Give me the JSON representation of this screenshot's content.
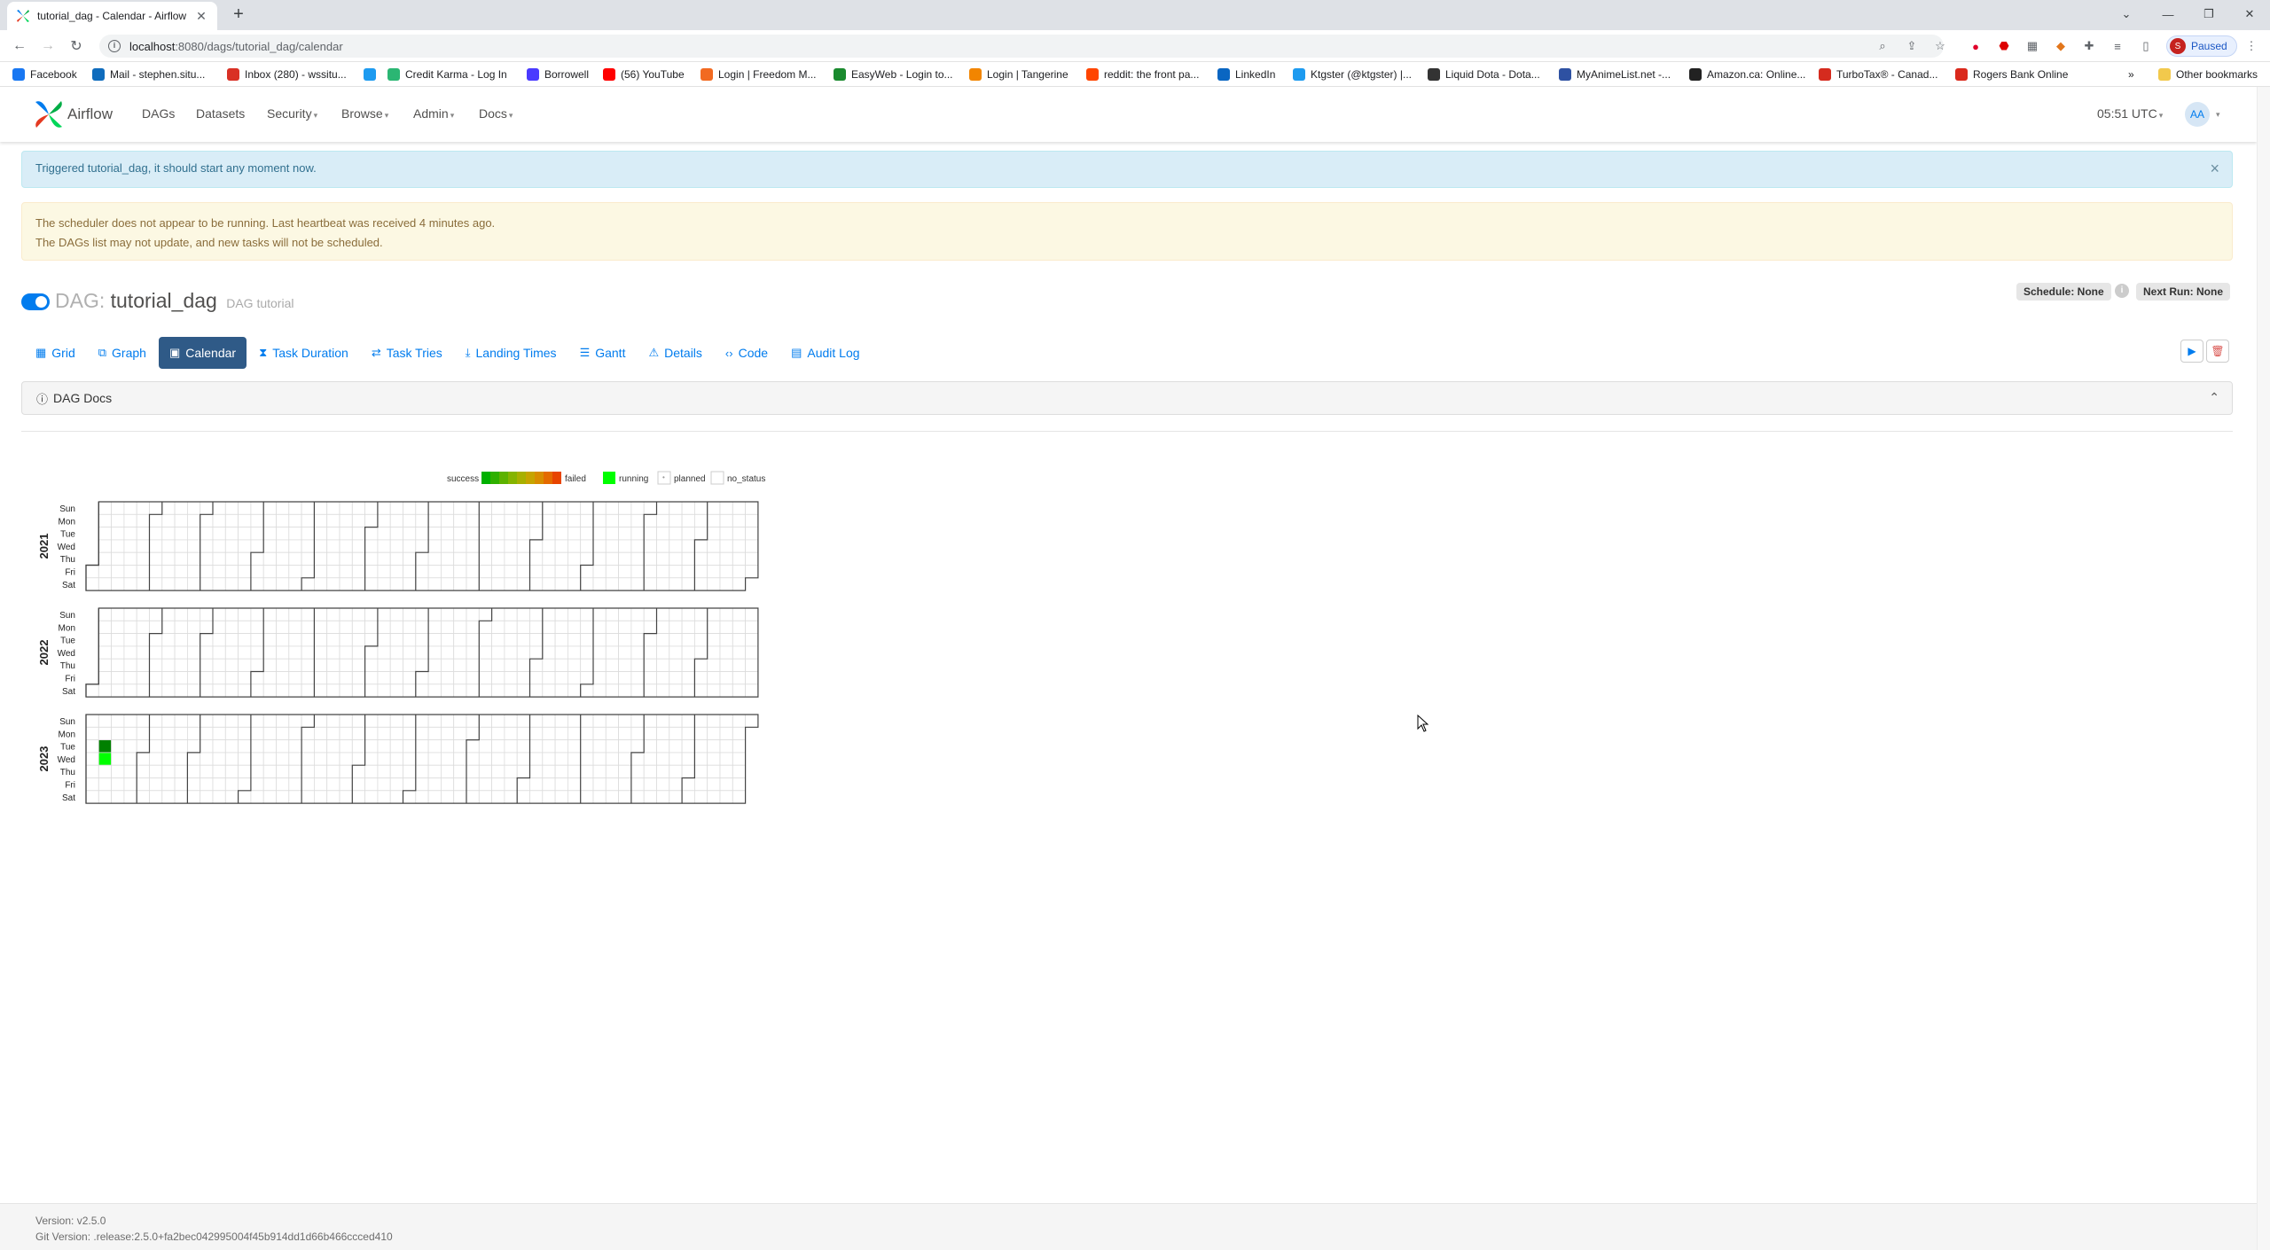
{
  "browser": {
    "tab_title": "tutorial_dag - Calendar - Airflow",
    "url_host": "localhost",
    "url_path": ":8080/dags/tutorial_dag/calendar",
    "profile_initial": "S",
    "profile_status": "Paused"
  },
  "bookmarks": [
    {
      "label": "Facebook",
      "icon": "facebook-icon",
      "color": "#1877f2"
    },
    {
      "label": "Mail - stephen.situ...",
      "icon": "outlook-icon",
      "color": "#0f6cbd"
    },
    {
      "label": "Inbox (280) - wssitu...",
      "icon": "gmail-icon",
      "color": "#d93025"
    },
    {
      "label": "",
      "icon": "twitter-icon",
      "color": "#1d9bf0"
    },
    {
      "label": "Credit Karma - Log In",
      "icon": "creditkarma-icon",
      "color": "#2bb673"
    },
    {
      "label": "Borrowell",
      "icon": "borrowell-icon",
      "color": "#4a3aff"
    },
    {
      "label": "(56) YouTube",
      "icon": "youtube-icon",
      "color": "#ff0000"
    },
    {
      "label": "Login | Freedom M...",
      "icon": "freedom-icon",
      "color": "#f26a21"
    },
    {
      "label": "EasyWeb - Login to...",
      "icon": "td-icon",
      "color": "#1a8a2e"
    },
    {
      "label": "Login | Tangerine",
      "icon": "tangerine-icon",
      "color": "#f28500"
    },
    {
      "label": "reddit: the front pa...",
      "icon": "reddit-icon",
      "color": "#ff4500"
    },
    {
      "label": "LinkedIn",
      "icon": "linkedin-icon",
      "color": "#0a66c2"
    },
    {
      "label": "Ktgster (@ktgster) |...",
      "icon": "twitter-icon",
      "color": "#1d9bf0"
    },
    {
      "label": "Liquid Dota - Dota...",
      "icon": "liquid-icon",
      "color": "#333333"
    },
    {
      "label": "MyAnimeList.net -...",
      "icon": "mal-icon",
      "color": "#2e51a2"
    },
    {
      "label": "Amazon.ca: Online...",
      "icon": "amazon-icon",
      "color": "#222222"
    },
    {
      "label": "TurboTax® - Canad...",
      "icon": "turbotax-icon",
      "color": "#d52b1e"
    },
    {
      "label": "Rogers Bank Online",
      "icon": "rogers-icon",
      "color": "#da291c"
    }
  ],
  "bookmarks_other": "Other bookmarks",
  "airflow": {
    "brand": "Airflow",
    "menu": [
      "DAGs",
      "Datasets",
      "Security",
      "Browse",
      "Admin",
      "Docs"
    ],
    "time": "05:51 UTC",
    "user_initials": "AA"
  },
  "alerts": {
    "info": "Triggered tutorial_dag, it should start any moment now.",
    "warn_line1": "The scheduler does not appear to be running. Last heartbeat was received 4 minutes ago.",
    "warn_line2": "The DAGs list may not update, and new tasks will not be scheduled."
  },
  "dag": {
    "label": "DAG:",
    "id": "tutorial_dag",
    "description": "DAG tutorial",
    "schedule": "Schedule: None",
    "next_run": "Next Run: None"
  },
  "tabs": [
    {
      "label": "Grid",
      "icon": "grid-icon",
      "active": false
    },
    {
      "label": "Graph",
      "icon": "graph-icon",
      "active": false
    },
    {
      "label": "Calendar",
      "icon": "calendar-icon",
      "active": true
    },
    {
      "label": "Task Duration",
      "icon": "hourglass-icon",
      "active": false
    },
    {
      "label": "Task Tries",
      "icon": "retry-icon",
      "active": false
    },
    {
      "label": "Landing Times",
      "icon": "landing-icon",
      "active": false
    },
    {
      "label": "Gantt",
      "icon": "gantt-icon",
      "active": false
    },
    {
      "label": "Details",
      "icon": "warning-icon",
      "active": false
    },
    {
      "label": "Code",
      "icon": "code-icon",
      "active": false
    },
    {
      "label": "Audit Log",
      "icon": "file-icon",
      "active": false
    }
  ],
  "docs_label": "DAG Docs",
  "calendar": {
    "legend": {
      "success": "success",
      "failed": "failed",
      "running": "running",
      "planned": "planned",
      "no_status": "no_status"
    },
    "colors": {
      "scale": [
        "#00b000",
        "#2fb000",
        "#5cb200",
        "#85b400",
        "#a8b000",
        "#c6a400",
        "#d88c00",
        "#e46a00",
        "#e84400"
      ],
      "running": "#00ff00",
      "success_dark": "#008000"
    },
    "days": [
      "Sun",
      "Mon",
      "Tue",
      "Wed",
      "Thu",
      "Fri",
      "Sat"
    ],
    "years": [
      "2021",
      "2022",
      "2023"
    ],
    "runs": [
      {
        "date": "2023-01-10",
        "state": "success"
      },
      {
        "date": "2023-01-11",
        "state": "running"
      }
    ]
  },
  "footer": {
    "version": "Version: v2.5.0",
    "git": "Git Version: .release:2.5.0+fa2bec042995004f45b914dd1d66b466ccced410"
  }
}
